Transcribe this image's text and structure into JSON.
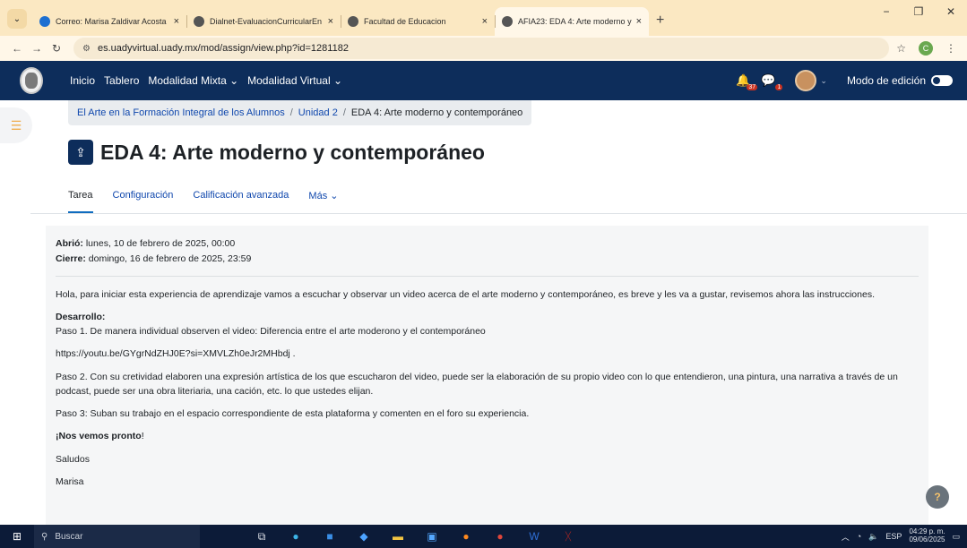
{
  "browser": {
    "tabs": [
      {
        "title": "Correo: Marisa Zaldivar Acosta",
        "close": "×",
        "favicon_color": "#1d6fd1"
      },
      {
        "title": "Dialnet-EvaluacionCurricularEn",
        "close": "×",
        "favicon_color": "#555555"
      },
      {
        "title": "Facultad de Educacion",
        "close": "×",
        "favicon_color": "#555555"
      },
      {
        "title": "AFIA23: EDA 4: Arte moderno y",
        "close": "×",
        "favicon_color": "#555555"
      }
    ],
    "new_tab": "+",
    "url": "es.uadyvirtual.uady.mx/mod/assign/view.php?id=1281182",
    "profile_initial": "C"
  },
  "navbar": {
    "links": [
      "Inicio",
      "Tablero",
      "Modalidad Mixta ⌄",
      "Modalidad Virtual ⌄"
    ],
    "notifications_count": "37",
    "messages_count": "1",
    "edit_mode_label": "Modo de edición"
  },
  "breadcrumb": {
    "items": [
      "El Arte en la Formación Integral de los Alumnos",
      "Unidad 2"
    ],
    "current": "EDA 4: Arte moderno y contemporáneo"
  },
  "page": {
    "title": "EDA 4: Arte moderno y contemporáneo"
  },
  "tabs": {
    "items": [
      "Tarea",
      "Configuración",
      "Calificación avanzada",
      "Más ⌄"
    ]
  },
  "assignment": {
    "opened_label": "Abrió:",
    "opened_value": "lunes, 10 de febrero de 2025, 00:00",
    "due_label": "Cierre:",
    "due_value": "domingo, 16 de febrero de 2025, 23:59",
    "intro": "Hola, para iniciar esta experiencia de aprendizaje vamos a escuchar y observar un video acerca de el arte moderno y contemporáneo, es breve y les va a gustar, revisemos ahora las instrucciones.",
    "dev_heading": "Desarrollo:",
    "step1": "Paso 1. De manera individual observen el video: Diferencia entre el arte moderono y el contemporáneo",
    "link": "https://youtu.be/GYgrNdZHJ0E?si=XMVLZh0eJr2MHbdj .",
    "step2": "Paso 2. Con su cretividad elaboren una expresión artística de los que escucharon del video, puede ser la elaboración de su propio video con lo que entendieron, una pintura, una narrativa a través de un podcast, puede ser una obra literiaria, una cación, etc. lo que ustedes elijan.",
    "step3": "Paso 3: Suban su trabajo en el espacio correspondiente de esta plataforma y comenten en el foro su experiencia.",
    "closing_bold": "¡Nos vemos pronto",
    "closing_end": "!",
    "greeting": "Saludos",
    "signature": "Marisa"
  },
  "help_button": "?",
  "taskbar": {
    "search_label": "Buscar",
    "language": "ESP",
    "time": "04:29 p. m.",
    "date": "09/06/2025"
  }
}
